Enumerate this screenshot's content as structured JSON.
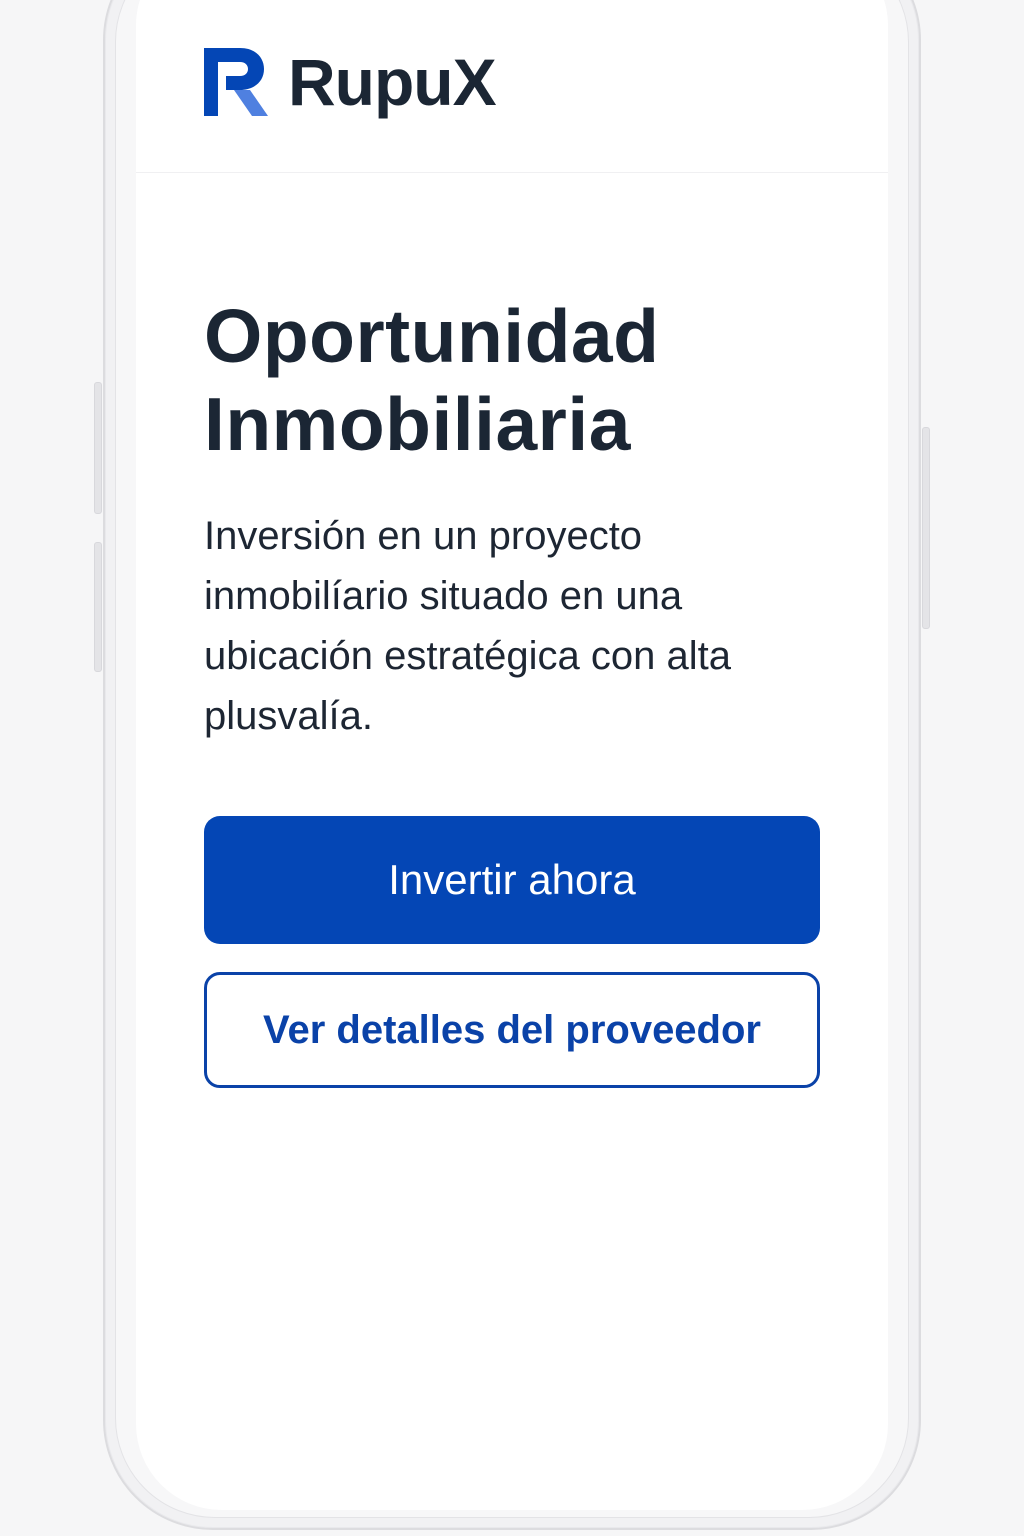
{
  "app": {
    "brand_name": "RupuX",
    "brand_icon": "rupux-r-logo-icon"
  },
  "hero": {
    "title_line_1": "Oportunidad",
    "title_line_2": "Inmobiliaria",
    "description_lines": [
      "Inversión en un proyecto",
      "inmobilíario situado en una",
      "ubicación estratégica con alta",
      "plusvalía."
    ]
  },
  "actions": {
    "primary_label": "Invertir ahora",
    "secondary_label": "Ver detalles del proveedor"
  },
  "colors": {
    "brand_blue": "#0446b5",
    "brand_blue_light": "#4f80e0",
    "text_dark": "#1b2634",
    "background": "#ffffff"
  }
}
